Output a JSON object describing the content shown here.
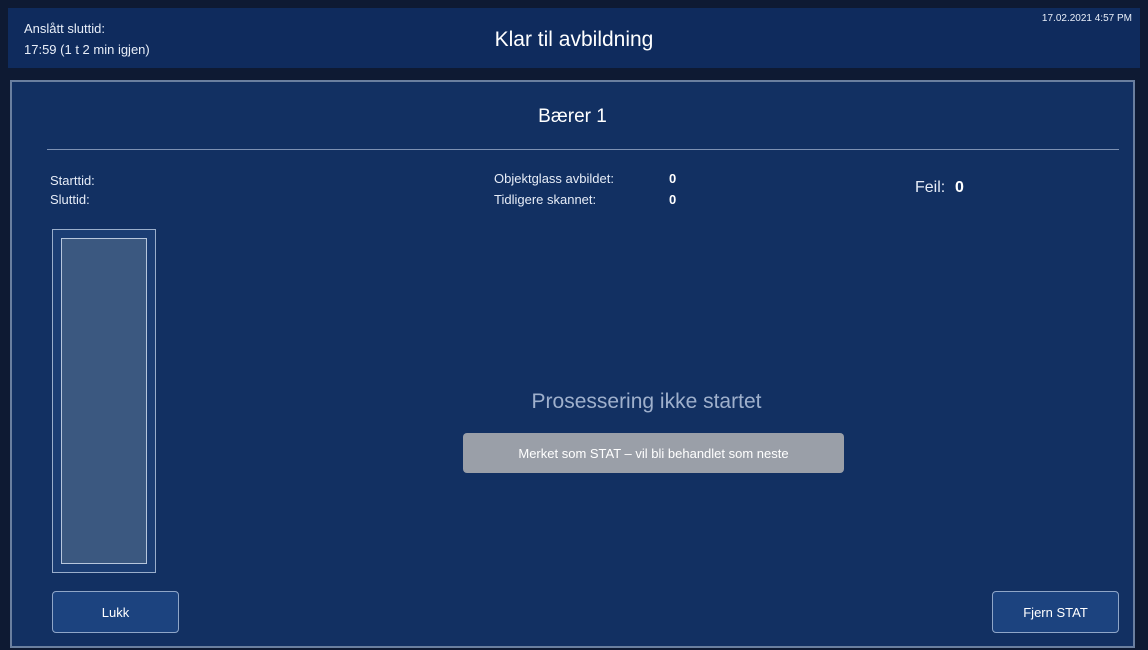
{
  "header": {
    "estimated_end_label": "Anslått sluttid:",
    "estimated_end_value": "17:59 (1 t 2 min igjen)",
    "title": "Klar til avbildning",
    "datetime": "17.02.2021 4:57 PM"
  },
  "panel": {
    "title": "Bærer 1",
    "start_label": "Starttid:",
    "end_label": "Sluttid:",
    "slides_imaged_label": "Objektglass avbildet:",
    "slides_imaged_value": "0",
    "previously_scanned_label": "Tidligere skannet:",
    "previously_scanned_value": "0",
    "errors_label": "Feil:",
    "errors_value": "0",
    "status_text": "Prosessering ikke startet",
    "stat_badge": "Merket som STAT – vil bli behandlet som neste"
  },
  "buttons": {
    "close": "Lukk",
    "remove_stat": "Fjern STAT"
  },
  "colors": {
    "header_bg": "#0f2b5d",
    "panel_bg": "#123062",
    "badge_bg": "#9a9fa8",
    "button_bg": "#1c437f"
  }
}
